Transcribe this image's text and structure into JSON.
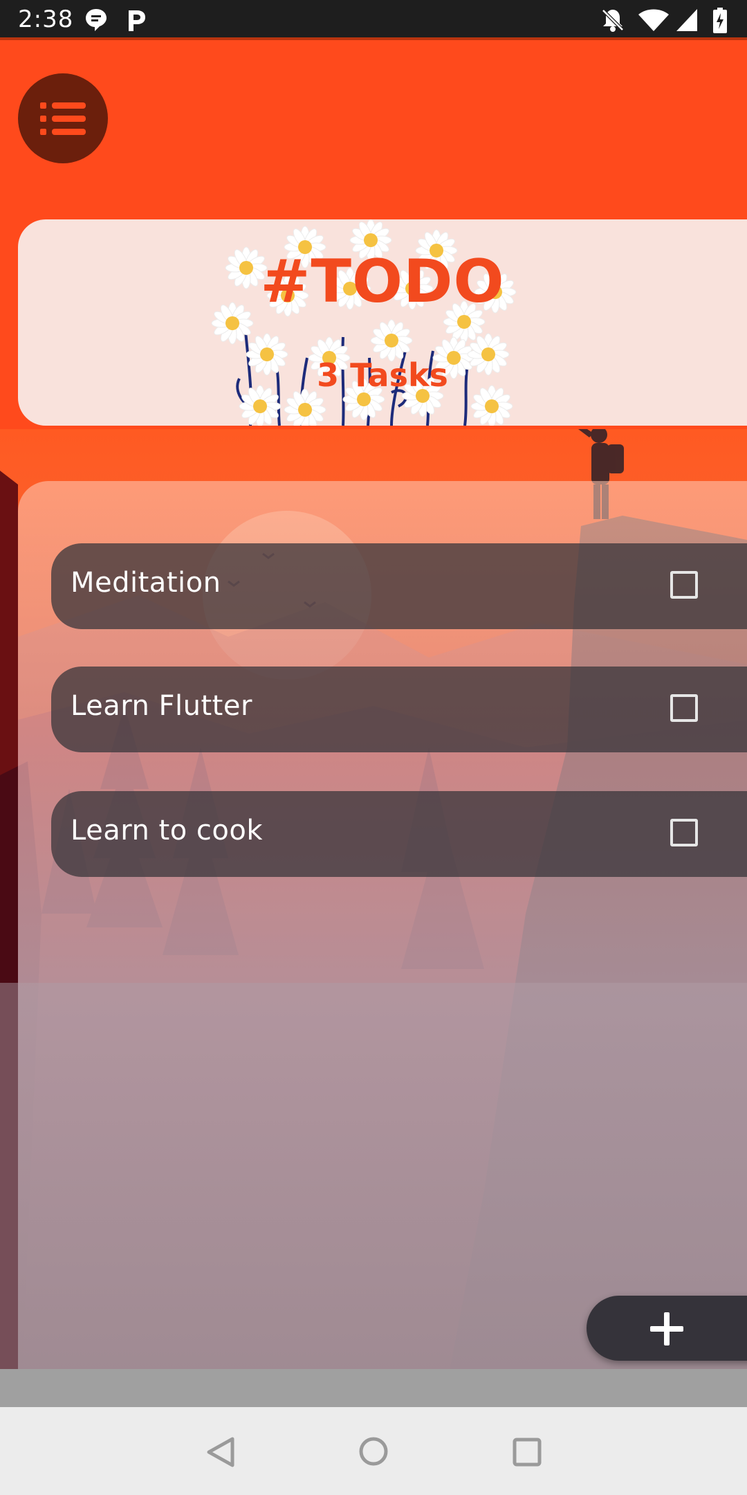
{
  "status_bar": {
    "time": "2:38",
    "left_icons": [
      "chat-bubble-icon",
      "parking-icon"
    ],
    "right_icons": [
      "notifications-off-icon",
      "wifi-icon",
      "cell-signal-icon",
      "battery-charging-icon"
    ]
  },
  "header": {
    "menu_icon": "list-menu-icon",
    "title": "#TODO",
    "subtitle": "3 Tasks"
  },
  "tasks": [
    {
      "label": "Meditation",
      "checked": false
    },
    {
      "label": "Learn Flutter",
      "checked": false
    },
    {
      "label": "Learn to cook",
      "checked": false
    }
  ],
  "fab": {
    "icon": "plus-icon"
  },
  "nav": {
    "icons": [
      "back-icon",
      "home-icon",
      "recents-icon"
    ]
  },
  "colors": {
    "accent": "#ff4a1c",
    "menu_button": "#6b1f0c",
    "card_bg": "#f9e2dc",
    "task_bg": "#37343a",
    "fab_bg": "#35333a"
  }
}
